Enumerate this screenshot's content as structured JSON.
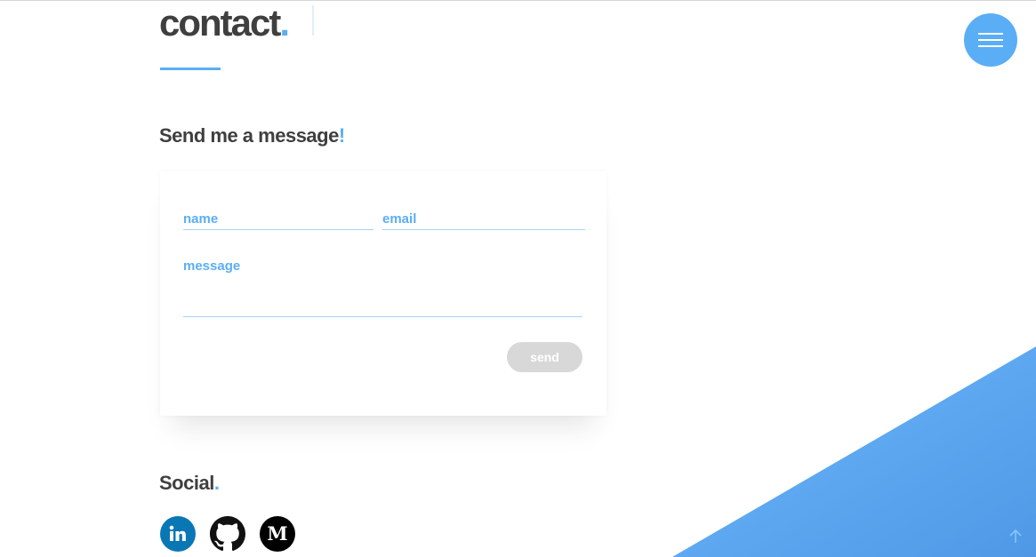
{
  "page": {
    "title": "contact",
    "title_dot": "."
  },
  "menu": {
    "icon": "hamburger-menu-icon"
  },
  "message_section": {
    "heading": "Send me a message",
    "heading_accent": "!"
  },
  "form": {
    "name_placeholder": "name",
    "email_placeholder": "email",
    "message_placeholder": "message",
    "send_label": "send"
  },
  "social_section": {
    "heading": "Social",
    "heading_accent": ".",
    "links": [
      {
        "name": "linkedin",
        "icon": "linkedin-icon",
        "label": "in"
      },
      {
        "name": "github",
        "icon": "github-icon"
      },
      {
        "name": "medium",
        "icon": "medium-icon",
        "label": "M"
      }
    ]
  },
  "scroll_top": {
    "icon": "arrow-up-icon"
  },
  "colors": {
    "accent": "#5aaef5",
    "text": "#3f3f3f",
    "linkedin": "#0a77b5",
    "button_disabled": "#d8d8d8"
  }
}
